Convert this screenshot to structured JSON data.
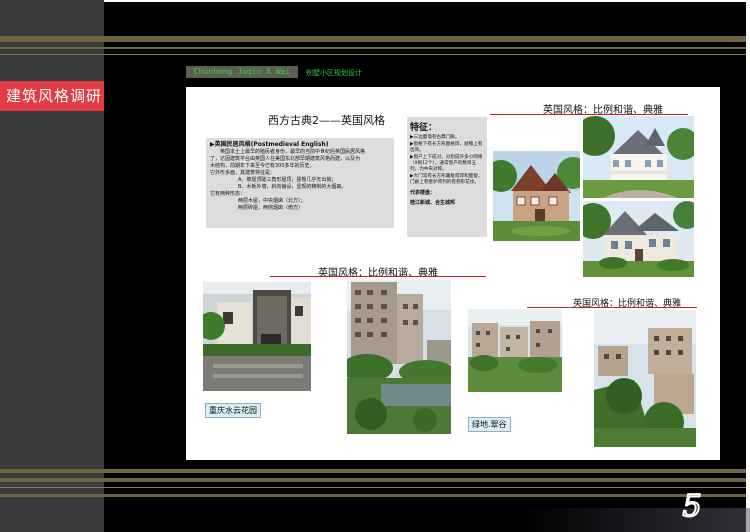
{
  "sidebar": {
    "title": "建筑风格调研"
  },
  "header": {
    "tag": "Chunhong  Juqin  A  Wei",
    "subtitle": "别墅小区规划设计"
  },
  "panel": {
    "main_title": "西方古典2——英国风格",
    "text_box": {
      "title": "▶英国民居风格(Postmedieval English)",
      "lines": [
        "英国本土上最早的殖民者身份，最早的当前中世纪后英国民居风格",
        "了，达因建筑平台由英国人在美国东北部早期建筑风格而建，以及为",
        "木结构，前期年下来至今已有300多年的历史。",
        "它外形多面，其建筑特征是：",
        "A、坡屋顶陡三角形屋顶，屋檐几乎无出挑；",
        "B、木板外墙，斜向铺设，显现的精制的大烟囱。",
        "它有两种形态：",
        "两层木屋，中央烟囱（北方）；",
        "两层砖屋，两侧烟囱（南方）"
      ]
    },
    "features": {
      "title": "特征：",
      "items": [
        "▶三边面墙有古典门廊。",
        "▶窗格下有长方形图格饰，屋檐上有齿饰。",
        "▶窗户上下成对，分割成许多小网格（9到12个），通常窗户的数目五列，为中央对称。",
        "▶大门常有长方形翼框或饰和面窗，门廊上有壁炉饰列的有券形花纹。"
      ],
      "footer": "代表楼盘：",
      "footer_value": "桂江新城、合生城邦"
    },
    "headings": [
      "英国风格：比例和谐、典雅",
      "英国风格：比例和谐、典雅",
      "英国风格：比例和谐、典雅"
    ],
    "captions": [
      "重庆水云花园",
      "绿地.翠谷"
    ]
  },
  "page_number": "5"
}
